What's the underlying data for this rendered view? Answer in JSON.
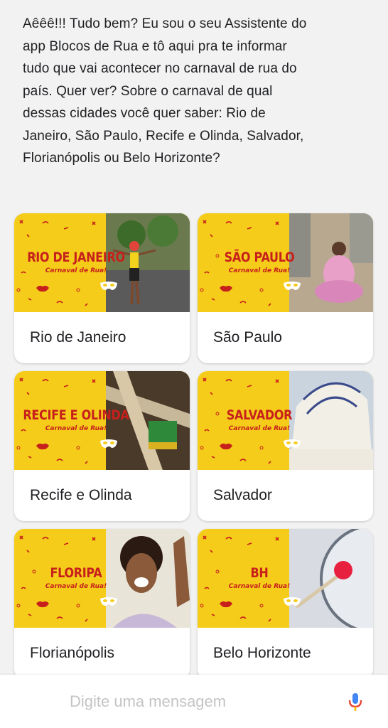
{
  "message": {
    "text": "Aêêê!!! Tudo bem? Eu sou o seu Assistente do app Blocos de Rua e tô aqui pra te informar tudo que vai acontecer no carnaval de rua do país. Quer ver? Sobre o carnaval de qual dessas cidades você quer saber: Rio de Janeiro, São Paulo, Recife e Olinda, Salvador, Florianópolis ou Belo Horizonte?"
  },
  "cards": [
    {
      "label": "Rio de Janeiro",
      "banner_title": "RIO DE JANEIRO",
      "banner_sub": "Carnaval de Rua!"
    },
    {
      "label": "São Paulo",
      "banner_title": "SÃO PAULO",
      "banner_sub": "Carnaval de Rua!"
    },
    {
      "label": "Recife e Olinda",
      "banner_title": "RECIFE E OLINDA",
      "banner_sub": "Carnaval de Rua!"
    },
    {
      "label": "Salvador",
      "banner_title": "SALVADOR",
      "banner_sub": "Carnaval de Rua!"
    },
    {
      "label": "Florianópolis",
      "banner_title": "FLORIPA",
      "banner_sub": "Carnaval de Rua!"
    },
    {
      "label": "Belo Horizonte",
      "banner_title": "BH",
      "banner_sub": "Carnaval de Rua!"
    }
  ],
  "input": {
    "placeholder": "Digite uma mensagem",
    "value": ""
  },
  "icons": {
    "mic": "microphone-icon",
    "mask": "carnival-mask-icon",
    "lips": "lips-icon"
  },
  "colors": {
    "banner_bg": "#f5cc1a",
    "banner_text": "#c7201c",
    "mic_blue": "#4285f4",
    "mic_red": "#ea4335"
  }
}
